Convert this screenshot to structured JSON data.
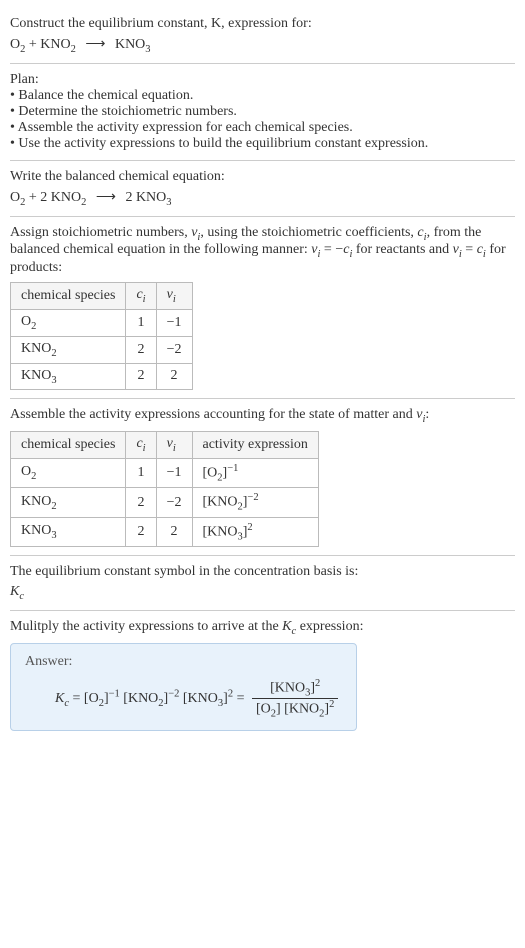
{
  "header": {
    "prompt_line1": "Construct the equilibrium constant, K, expression for:",
    "equation_lhs1": "O",
    "equation_sub1": "2",
    "plus": " + ",
    "equation_lhs2": "KNO",
    "equation_sub2": "2",
    "arrow": "⟶",
    "equation_rhs": "KNO",
    "equation_rhs_sub": "3"
  },
  "plan": {
    "title": "Plan:",
    "b1": "• Balance the chemical equation.",
    "b2": "• Determine the stoichiometric numbers.",
    "b3": "• Assemble the activity expression for each chemical species.",
    "b4": "• Use the activity expressions to build the equilibrium constant expression."
  },
  "balanced": {
    "intro": "Write the balanced chemical equation:",
    "lhs1": "O",
    "lhs1_sub": "2",
    "plus": " + 2 KNO",
    "lhs2_sub": "2",
    "arrow": "⟶",
    "rhs_coef": " 2 KNO",
    "rhs_sub": "3"
  },
  "assign_intro_a": "Assign stoichiometric numbers, ",
  "assign_intro_ni": "ν",
  "assign_intro_i": "i",
  "assign_intro_b": ", using the stoichiometric coefficients, ",
  "assign_intro_ci": "c",
  "assign_intro_c": ", from the balanced chemical equation in the following manner: ",
  "assign_rel_react": " = −",
  "assign_rel_react2": " for reactants and ",
  "assign_rel_prod": " = ",
  "assign_rel_prod2": " for products:",
  "table1": {
    "h1": "chemical species",
    "h2": "c",
    "h2_sub": "i",
    "h3": "ν",
    "h3_sub": "i",
    "rows": [
      {
        "sp": "O",
        "sp_sub": "2",
        "c": "1",
        "n": "−1"
      },
      {
        "sp": "KNO",
        "sp_sub": "2",
        "c": "2",
        "n": "−2"
      },
      {
        "sp": "KNO",
        "sp_sub": "3",
        "c": "2",
        "n": "2"
      }
    ]
  },
  "activity_intro_a": "Assemble the activity expressions accounting for the state of matter and ",
  "activity_intro_b": ":",
  "table2": {
    "h1": "chemical species",
    "h2": "c",
    "h2_sub": "i",
    "h3": "ν",
    "h3_sub": "i",
    "h4": "activity expression",
    "rows": [
      {
        "sp": "O",
        "sp_sub": "2",
        "c": "1",
        "n": "−1",
        "ae_base": "[O",
        "ae_sub": "2",
        "ae_close": "]",
        "ae_sup": "−1"
      },
      {
        "sp": "KNO",
        "sp_sub": "2",
        "c": "2",
        "n": "−2",
        "ae_base": "[KNO",
        "ae_sub": "2",
        "ae_close": "]",
        "ae_sup": "−2"
      },
      {
        "sp": "KNO",
        "sp_sub": "3",
        "c": "2",
        "n": "2",
        "ae_base": "[KNO",
        "ae_sub": "3",
        "ae_close": "]",
        "ae_sup": "2"
      }
    ]
  },
  "kc_symbol": {
    "intro": "The equilibrium constant symbol in the concentration basis is:",
    "sym": "K",
    "sym_sub": "c"
  },
  "multiply": {
    "intro_a": "Mulitply the activity expressions to arrive at the ",
    "sym": "K",
    "sym_sub": "c",
    "intro_b": " expression:"
  },
  "answer": {
    "label": "Answer:",
    "kc": "K",
    "kc_sub": "c",
    "eq": " = ",
    "t1_b": "[O",
    "t1_s": "2",
    "t1_c": "]",
    "t1_p": "−1",
    "sp": " ",
    "t2_b": "[KNO",
    "t2_s": "2",
    "t2_c": "]",
    "t2_p": "−2",
    "t3_b": "[KNO",
    "t3_s": "3",
    "t3_c": "]",
    "t3_p": "2",
    "eq2": " = ",
    "num_b": "[KNO",
    "num_s": "3",
    "num_c": "]",
    "num_p": "2",
    "den1_b": "[O",
    "den1_s": "2",
    "den1_c": "] ",
    "den2_b": "[KNO",
    "den2_s": "2",
    "den2_c": "]",
    "den2_p": "2"
  }
}
